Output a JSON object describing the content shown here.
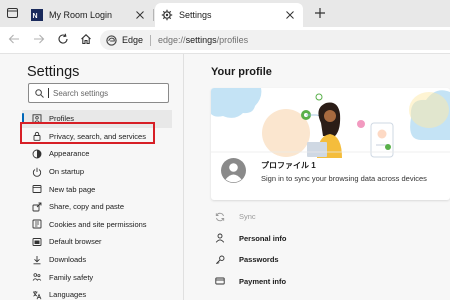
{
  "tabs": [
    {
      "title": "My Room Login",
      "icon": "site-favicon"
    },
    {
      "title": "Settings",
      "icon": "settings-gear-icon"
    }
  ],
  "address_bar": {
    "site_label": "Edge",
    "url_scheme": "edge://",
    "url_host": "settings",
    "url_path": "/profiles"
  },
  "sidebar": {
    "title": "Settings",
    "search_placeholder": "Search settings",
    "items": [
      {
        "label": "Profiles",
        "icon": "profile-icon",
        "selected": true
      },
      {
        "label": "Privacy, search, and services",
        "icon": "lock-icon"
      },
      {
        "label": "Appearance",
        "icon": "appearance-icon"
      },
      {
        "label": "On startup",
        "icon": "power-icon"
      },
      {
        "label": "New tab page",
        "icon": "new-tab-icon"
      },
      {
        "label": "Share, copy and paste",
        "icon": "share-icon"
      },
      {
        "label": "Cookies and site permissions",
        "icon": "cookies-icon"
      },
      {
        "label": "Default browser",
        "icon": "browser-icon"
      },
      {
        "label": "Downloads",
        "icon": "download-icon"
      },
      {
        "label": "Family safety",
        "icon": "family-icon"
      },
      {
        "label": "Languages",
        "icon": "languages-icon"
      }
    ]
  },
  "main": {
    "heading": "Your profile",
    "profile": {
      "name": "プロファイル 1",
      "subtitle": "Sign in to sync your browsing data across devices"
    },
    "items": [
      {
        "label": "Sync",
        "icon": "sync-icon",
        "disabled": true
      },
      {
        "label": "Personal info",
        "icon": "personal-info-icon"
      },
      {
        "label": "Passwords",
        "icon": "key-icon"
      },
      {
        "label": "Payment info",
        "icon": "card-icon"
      }
    ]
  },
  "colors": {
    "accent": "#0067b8",
    "highlight": "#d71f26"
  }
}
